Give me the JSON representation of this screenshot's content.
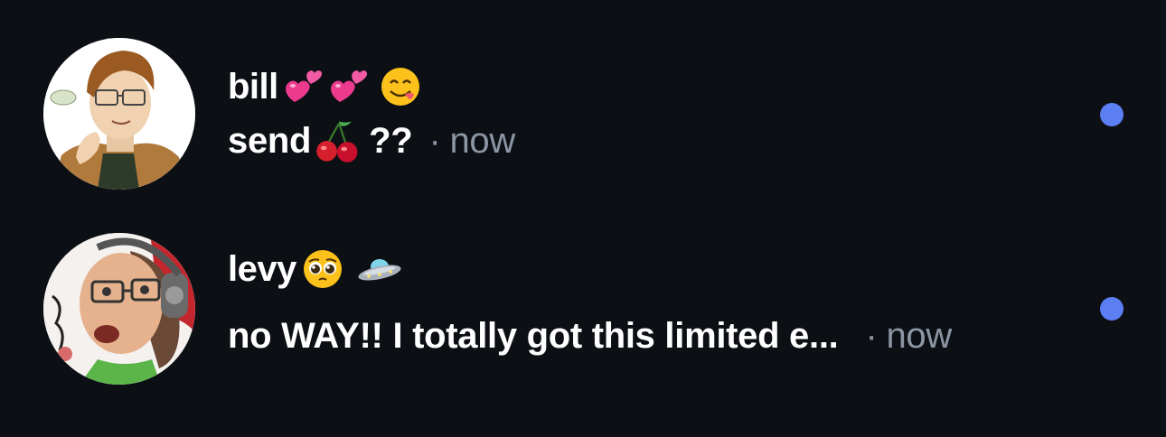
{
  "threads": [
    {
      "name": "bill",
      "name_emojis": [
        "two-hearts",
        "two-hearts",
        "face-savoring-food"
      ],
      "message_text": "send",
      "message_emoji": "cherries",
      "message_suffix": "??",
      "separator": "·",
      "time": "now",
      "unread": true
    },
    {
      "name": "levy",
      "name_emojis": [
        "pleading-face",
        "flying-saucer"
      ],
      "message_text": "no WAY!! I totally got this limited e...",
      "separator": "·",
      "time": "now",
      "unread": true
    }
  ],
  "colors": {
    "background": "#0c0f14",
    "text": "#ffffff",
    "muted": "#8b95a3",
    "unread_dot": "#5b7ef2"
  }
}
